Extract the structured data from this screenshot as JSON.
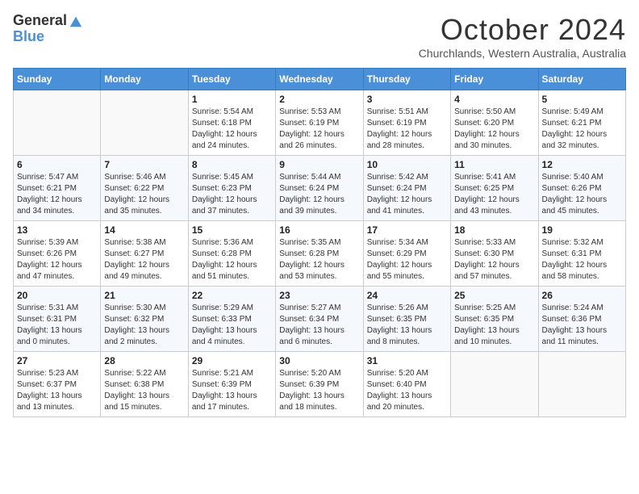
{
  "header": {
    "logo_general": "General",
    "logo_blue": "Blue",
    "month_title": "October 2024",
    "location": "Churchlands, Western Australia, Australia"
  },
  "days_of_week": [
    "Sunday",
    "Monday",
    "Tuesday",
    "Wednesday",
    "Thursday",
    "Friday",
    "Saturday"
  ],
  "weeks": [
    [
      {
        "day": "",
        "detail": ""
      },
      {
        "day": "",
        "detail": ""
      },
      {
        "day": "1",
        "detail": "Sunrise: 5:54 AM\nSunset: 6:18 PM\nDaylight: 12 hours and 24 minutes."
      },
      {
        "day": "2",
        "detail": "Sunrise: 5:53 AM\nSunset: 6:19 PM\nDaylight: 12 hours and 26 minutes."
      },
      {
        "day": "3",
        "detail": "Sunrise: 5:51 AM\nSunset: 6:19 PM\nDaylight: 12 hours and 28 minutes."
      },
      {
        "day": "4",
        "detail": "Sunrise: 5:50 AM\nSunset: 6:20 PM\nDaylight: 12 hours and 30 minutes."
      },
      {
        "day": "5",
        "detail": "Sunrise: 5:49 AM\nSunset: 6:21 PM\nDaylight: 12 hours and 32 minutes."
      }
    ],
    [
      {
        "day": "6",
        "detail": "Sunrise: 5:47 AM\nSunset: 6:21 PM\nDaylight: 12 hours and 34 minutes."
      },
      {
        "day": "7",
        "detail": "Sunrise: 5:46 AM\nSunset: 6:22 PM\nDaylight: 12 hours and 35 minutes."
      },
      {
        "day": "8",
        "detail": "Sunrise: 5:45 AM\nSunset: 6:23 PM\nDaylight: 12 hours and 37 minutes."
      },
      {
        "day": "9",
        "detail": "Sunrise: 5:44 AM\nSunset: 6:24 PM\nDaylight: 12 hours and 39 minutes."
      },
      {
        "day": "10",
        "detail": "Sunrise: 5:42 AM\nSunset: 6:24 PM\nDaylight: 12 hours and 41 minutes."
      },
      {
        "day": "11",
        "detail": "Sunrise: 5:41 AM\nSunset: 6:25 PM\nDaylight: 12 hours and 43 minutes."
      },
      {
        "day": "12",
        "detail": "Sunrise: 5:40 AM\nSunset: 6:26 PM\nDaylight: 12 hours and 45 minutes."
      }
    ],
    [
      {
        "day": "13",
        "detail": "Sunrise: 5:39 AM\nSunset: 6:26 PM\nDaylight: 12 hours and 47 minutes."
      },
      {
        "day": "14",
        "detail": "Sunrise: 5:38 AM\nSunset: 6:27 PM\nDaylight: 12 hours and 49 minutes."
      },
      {
        "day": "15",
        "detail": "Sunrise: 5:36 AM\nSunset: 6:28 PM\nDaylight: 12 hours and 51 minutes."
      },
      {
        "day": "16",
        "detail": "Sunrise: 5:35 AM\nSunset: 6:28 PM\nDaylight: 12 hours and 53 minutes."
      },
      {
        "day": "17",
        "detail": "Sunrise: 5:34 AM\nSunset: 6:29 PM\nDaylight: 12 hours and 55 minutes."
      },
      {
        "day": "18",
        "detail": "Sunrise: 5:33 AM\nSunset: 6:30 PM\nDaylight: 12 hours and 57 minutes."
      },
      {
        "day": "19",
        "detail": "Sunrise: 5:32 AM\nSunset: 6:31 PM\nDaylight: 12 hours and 58 minutes."
      }
    ],
    [
      {
        "day": "20",
        "detail": "Sunrise: 5:31 AM\nSunset: 6:31 PM\nDaylight: 13 hours and 0 minutes."
      },
      {
        "day": "21",
        "detail": "Sunrise: 5:30 AM\nSunset: 6:32 PM\nDaylight: 13 hours and 2 minutes."
      },
      {
        "day": "22",
        "detail": "Sunrise: 5:29 AM\nSunset: 6:33 PM\nDaylight: 13 hours and 4 minutes."
      },
      {
        "day": "23",
        "detail": "Sunrise: 5:27 AM\nSunset: 6:34 PM\nDaylight: 13 hours and 6 minutes."
      },
      {
        "day": "24",
        "detail": "Sunrise: 5:26 AM\nSunset: 6:35 PM\nDaylight: 13 hours and 8 minutes."
      },
      {
        "day": "25",
        "detail": "Sunrise: 5:25 AM\nSunset: 6:35 PM\nDaylight: 13 hours and 10 minutes."
      },
      {
        "day": "26",
        "detail": "Sunrise: 5:24 AM\nSunset: 6:36 PM\nDaylight: 13 hours and 11 minutes."
      }
    ],
    [
      {
        "day": "27",
        "detail": "Sunrise: 5:23 AM\nSunset: 6:37 PM\nDaylight: 13 hours and 13 minutes."
      },
      {
        "day": "28",
        "detail": "Sunrise: 5:22 AM\nSunset: 6:38 PM\nDaylight: 13 hours and 15 minutes."
      },
      {
        "day": "29",
        "detail": "Sunrise: 5:21 AM\nSunset: 6:39 PM\nDaylight: 13 hours and 17 minutes."
      },
      {
        "day": "30",
        "detail": "Sunrise: 5:20 AM\nSunset: 6:39 PM\nDaylight: 13 hours and 18 minutes."
      },
      {
        "day": "31",
        "detail": "Sunrise: 5:20 AM\nSunset: 6:40 PM\nDaylight: 13 hours and 20 minutes."
      },
      {
        "day": "",
        "detail": ""
      },
      {
        "day": "",
        "detail": ""
      }
    ]
  ]
}
